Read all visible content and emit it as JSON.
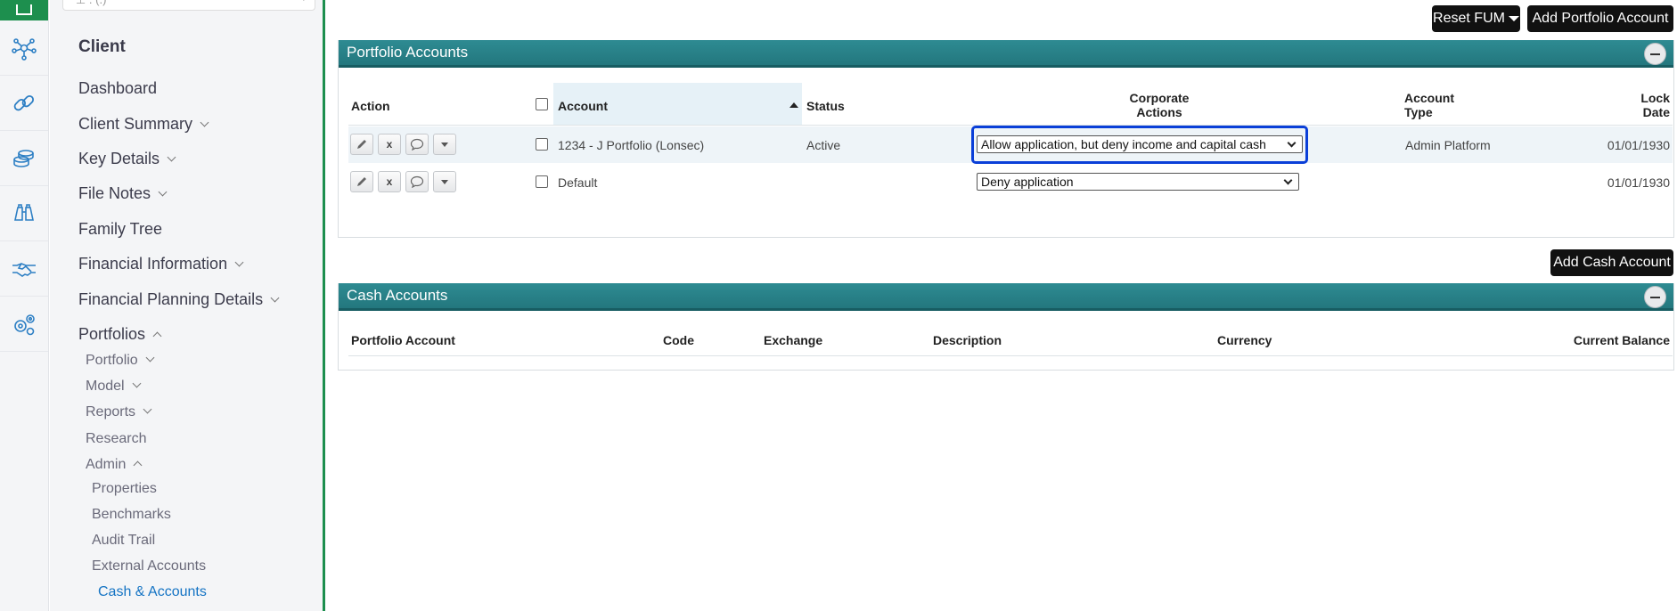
{
  "rail": {
    "items": [
      {
        "icon": "network-icon"
      },
      {
        "icon": "link-icon"
      },
      {
        "icon": "coins-icon"
      },
      {
        "icon": "binoculars-icon"
      },
      {
        "icon": "handshake-icon"
      },
      {
        "icon": "gears-icon"
      }
    ]
  },
  "sidebar": {
    "search_placeholder": "⊥ . (.)",
    "title": "Client",
    "nav": {
      "dashboard": "Dashboard",
      "client_summary": "Client Summary",
      "key_details": "Key Details",
      "file_notes": "File Notes",
      "family_tree": "Family Tree",
      "financial_information": "Financial Information",
      "financial_planning_details": "Financial Planning Details",
      "portfolios": "Portfolios",
      "portfolio": "Portfolio",
      "model": "Model",
      "reports": "Reports",
      "research": "Research",
      "admin": "Admin",
      "properties": "Properties",
      "benchmarks": "Benchmarks",
      "audit_trail": "Audit Trail",
      "external_accounts": "External Accounts",
      "cash_accounts": "Cash & Accounts"
    }
  },
  "toolbar": {
    "reset_fum": "Reset FUM",
    "add_portfolio_account": "Add Portfolio Account",
    "add_cash_account": "Add Cash Account"
  },
  "portfolio_accounts": {
    "title": "Portfolio Accounts",
    "headers": {
      "action": "Action",
      "account": "Account",
      "status": "Status",
      "corporate_actions_1": "Corporate",
      "corporate_actions_2": "Actions",
      "account_type_1": "Account",
      "account_type_2": "Type",
      "lock_date_1": "Lock",
      "lock_date_2": "Date"
    },
    "rows": [
      {
        "account": "1234 - J Portfolio (Lonsec)",
        "status": "Active",
        "corporate_actions": "Allow application, but deny income and capital cash",
        "account_type": "Admin Platform",
        "lock_date": "01/01/1930"
      },
      {
        "account": "Default",
        "status": "",
        "corporate_actions": "Deny application",
        "account_type": "",
        "lock_date": "01/01/1930"
      }
    ],
    "action_buttons": {
      "delete": "x"
    }
  },
  "cash_accounts": {
    "title": "Cash Accounts",
    "headers": {
      "portfolio_account": "Portfolio Account",
      "code": "Code",
      "exchange": "Exchange",
      "description": "Description",
      "currency": "Currency",
      "current_balance": "Current Balance"
    }
  },
  "colors": {
    "brand_green": "#1d8f4e",
    "panel_teal": "#2a848b",
    "link_blue": "#1574c4",
    "focus_blue": "#0a3fd8"
  }
}
